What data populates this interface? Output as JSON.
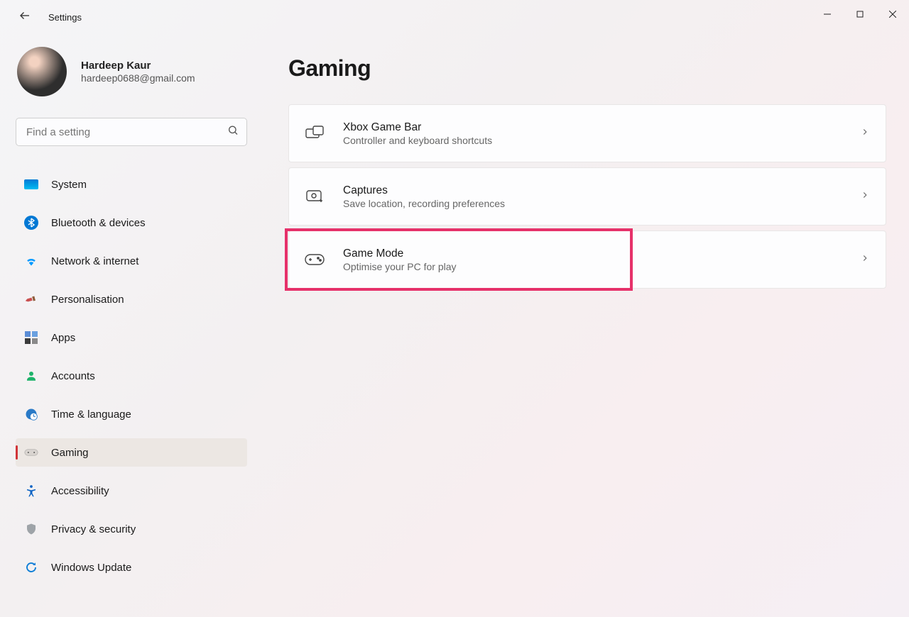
{
  "window": {
    "title": "Settings"
  },
  "user": {
    "name": "Hardeep Kaur",
    "email": "hardeep0688@gmail.com"
  },
  "search": {
    "placeholder": "Find a setting"
  },
  "nav": {
    "items": [
      {
        "label": "System"
      },
      {
        "label": "Bluetooth & devices"
      },
      {
        "label": "Network & internet"
      },
      {
        "label": "Personalisation"
      },
      {
        "label": "Apps"
      },
      {
        "label": "Accounts"
      },
      {
        "label": "Time & language"
      },
      {
        "label": "Gaming"
      },
      {
        "label": "Accessibility"
      },
      {
        "label": "Privacy & security"
      },
      {
        "label": "Windows Update"
      }
    ],
    "active_index": 7
  },
  "page": {
    "title": "Gaming",
    "cards": [
      {
        "title": "Xbox Game Bar",
        "subtitle": "Controller and keyboard shortcuts"
      },
      {
        "title": "Captures",
        "subtitle": "Save location, recording preferences"
      },
      {
        "title": "Game Mode",
        "subtitle": "Optimise your PC for play"
      }
    ],
    "highlighted_index": 2
  }
}
